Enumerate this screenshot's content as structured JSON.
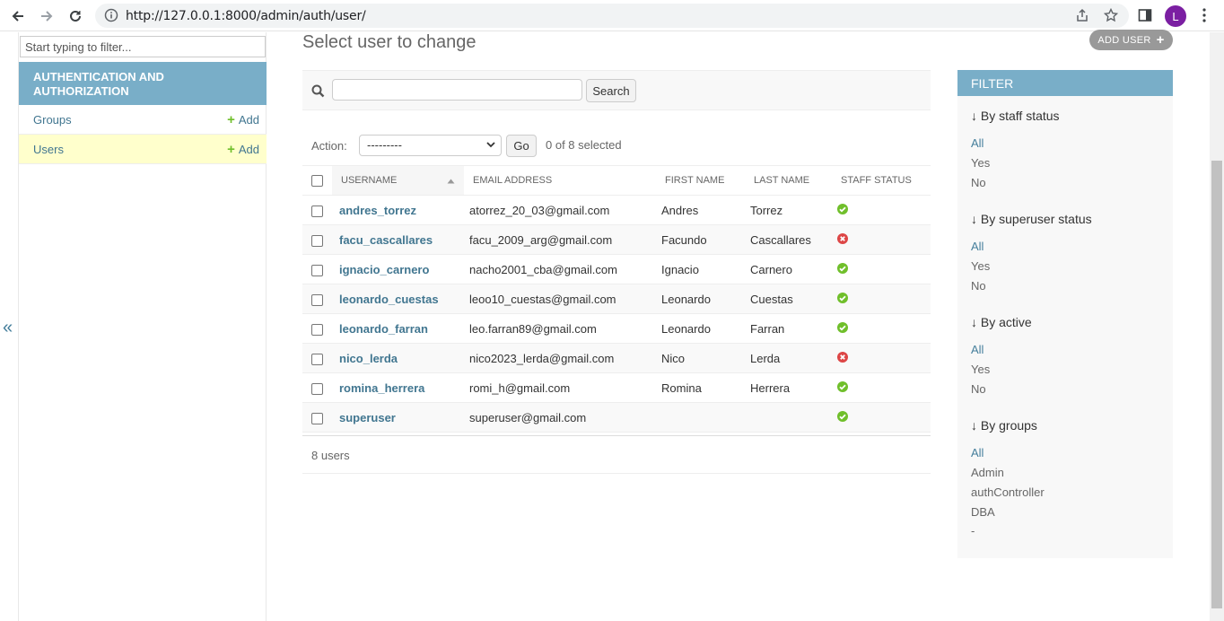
{
  "browser": {
    "url": "http://127.0.0.1:8000/admin/auth/user/",
    "avatar_letter": "L"
  },
  "nav": {
    "filter_placeholder": "Start typing to filter...",
    "app_caption": "Authentication and Authorization",
    "models": [
      {
        "name": "Groups",
        "add": "Add"
      },
      {
        "name": "Users",
        "add": "Add"
      }
    ],
    "toggle": "«"
  },
  "main": {
    "title": "Select user to change",
    "add_button": "ADD USER",
    "search_button": "Search",
    "action_label": "Action:",
    "action_value": "---------",
    "go_button": "Go",
    "selected_count": "0 of 8 selected",
    "columns": [
      "Username",
      "Email address",
      "First name",
      "Last name",
      "Staff status"
    ],
    "rows": [
      {
        "username": "andres_torrez",
        "email": "atorrez_20_03@gmail.com",
        "first": "Andres",
        "last": "Torrez",
        "staff": true
      },
      {
        "username": "facu_cascallares",
        "email": "facu_2009_arg@gmail.com",
        "first": "Facundo",
        "last": "Cascallares",
        "staff": false
      },
      {
        "username": "ignacio_carnero",
        "email": "nacho2001_cba@gmail.com",
        "first": "Ignacio",
        "last": "Carnero",
        "staff": true
      },
      {
        "username": "leonardo_cuestas",
        "email": "leoo10_cuestas@gmail.com",
        "first": "Leonardo",
        "last": "Cuestas",
        "staff": true
      },
      {
        "username": "leonardo_farran",
        "email": "leo.farran89@gmail.com",
        "first": "Leonardo",
        "last": "Farran",
        "staff": true
      },
      {
        "username": "nico_lerda",
        "email": "nico2023_lerda@gmail.com",
        "first": "Nico",
        "last": "Lerda",
        "staff": false
      },
      {
        "username": "romina_herrera",
        "email": "romi_h@gmail.com",
        "first": "Romina",
        "last": "Herrera",
        "staff": true
      },
      {
        "username": "superuser",
        "email": "superuser@gmail.com",
        "first": "",
        "last": "",
        "staff": true
      }
    ],
    "paginator": "8 users"
  },
  "filter": {
    "title": "FILTER",
    "groups": [
      {
        "heading": "↓ By staff status",
        "options": [
          "All",
          "Yes",
          "No"
        ]
      },
      {
        "heading": "↓ By superuser status",
        "options": [
          "All",
          "Yes",
          "No"
        ]
      },
      {
        "heading": "↓ By active",
        "options": [
          "All",
          "Yes",
          "No"
        ]
      },
      {
        "heading": "↓ By groups",
        "options": [
          "All",
          "Admin",
          "authController",
          "DBA",
          "-"
        ]
      }
    ]
  },
  "colors": {
    "caption": "#79aec8",
    "link": "#417690",
    "yes": "#70bf2b",
    "no": "#dd4646",
    "highlight": "#ffffcc"
  }
}
